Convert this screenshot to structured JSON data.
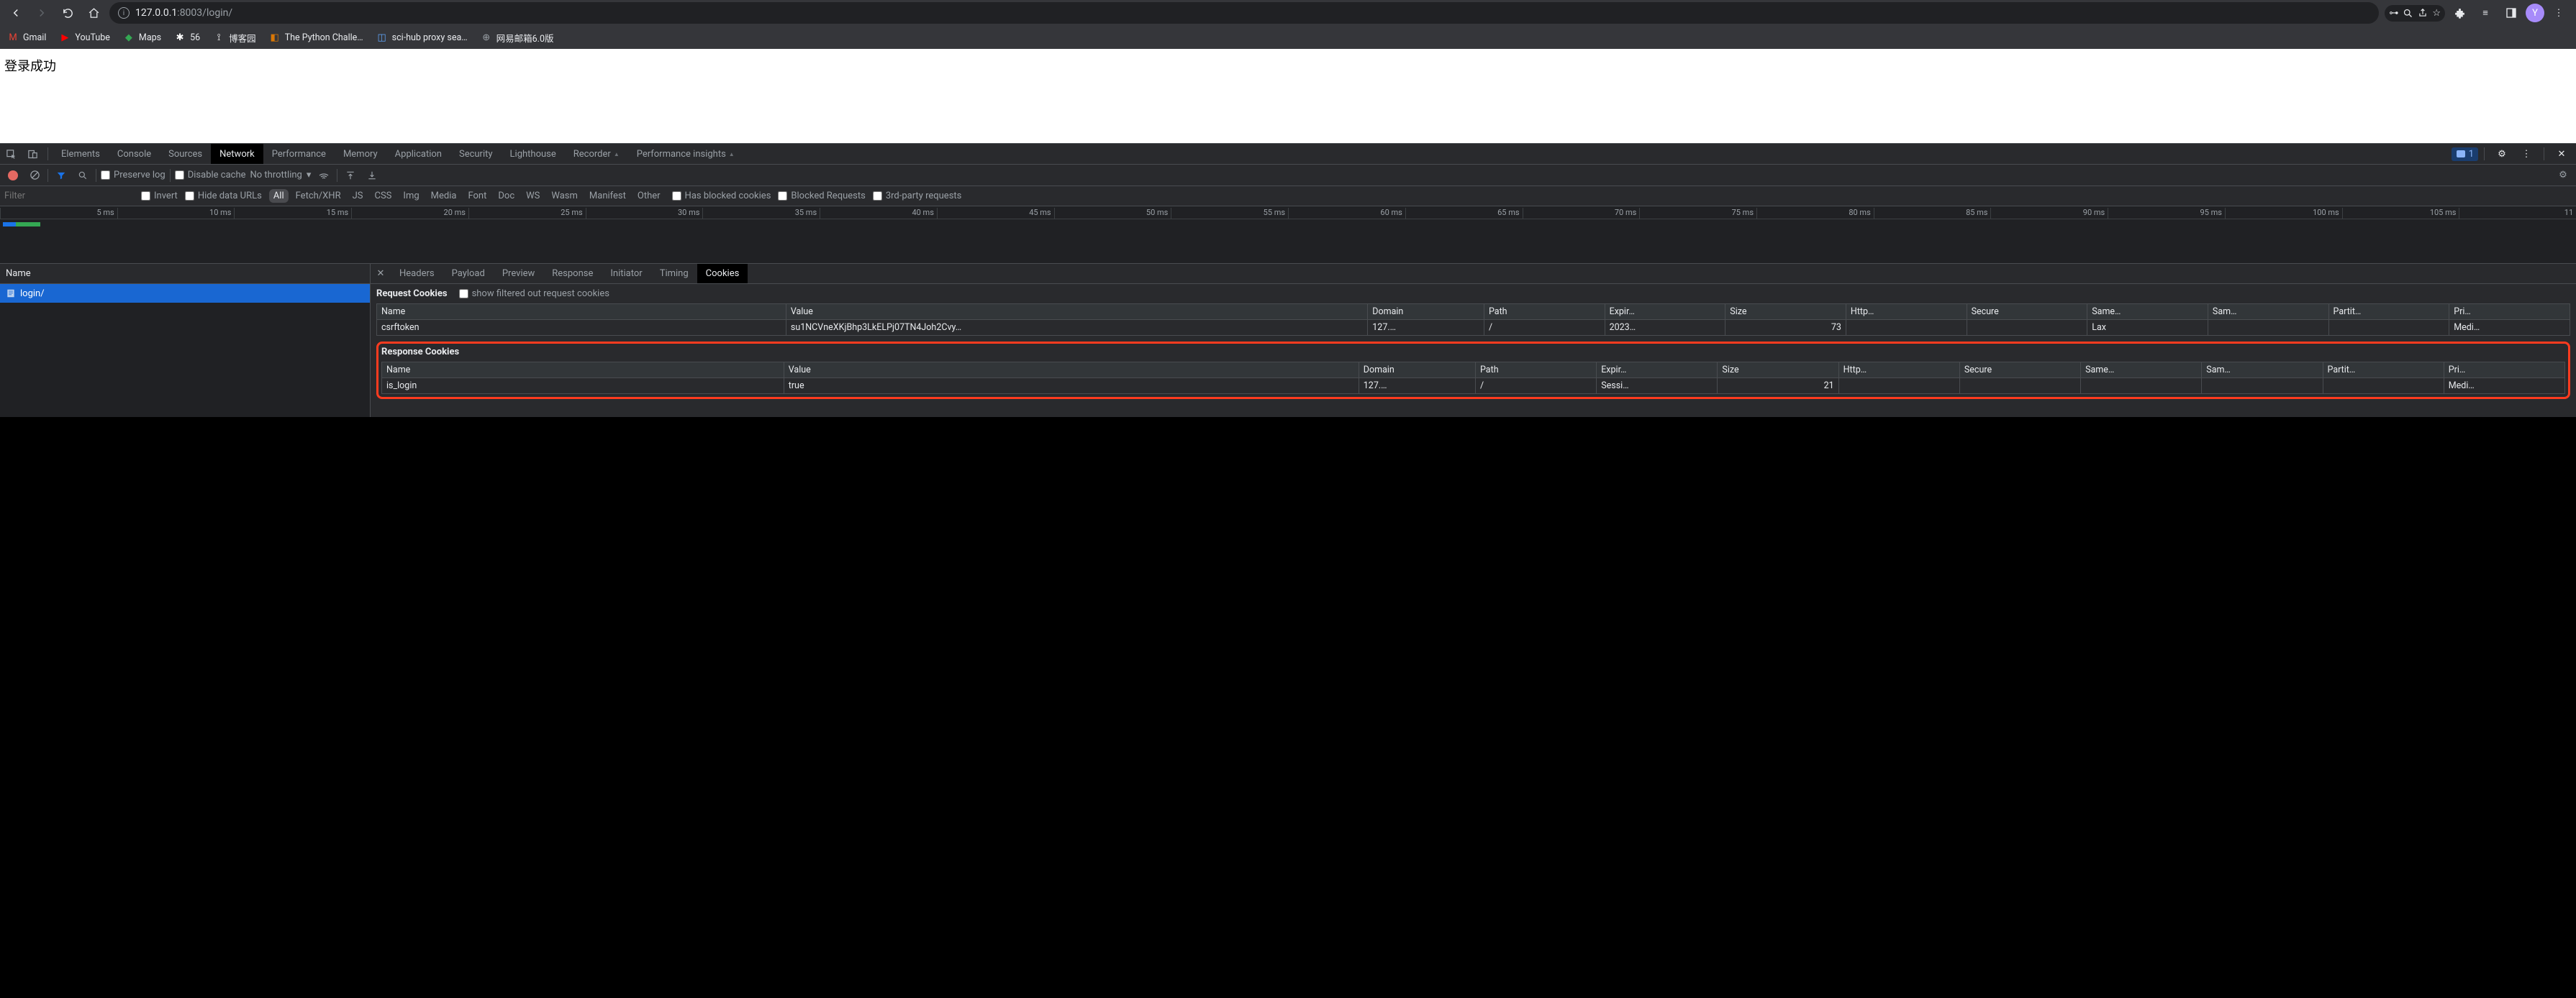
{
  "browser": {
    "url_host": "127.0.0.1",
    "url_port": ":8003",
    "url_path": "/login/",
    "profile_initial": "Y"
  },
  "bookmarks": [
    {
      "label": "Gmail",
      "icon": "M",
      "color": "#ea4335"
    },
    {
      "label": "YouTube",
      "icon": "▶",
      "color": "#ff0000"
    },
    {
      "label": "Maps",
      "icon": "◆",
      "color": "#34a853"
    },
    {
      "label": "56",
      "icon": "✱",
      "color": "#fff"
    },
    {
      "label": "博客园",
      "icon": "⟟",
      "color": "#fff"
    },
    {
      "label": "The Python Challe…",
      "icon": "◧",
      "color": "#d97706"
    },
    {
      "label": "sci-hub proxy sea…",
      "icon": "◫",
      "color": "#60a5fa"
    },
    {
      "label": "网易邮箱6.0版",
      "icon": "⊕",
      "color": "#9aa0a6"
    }
  ],
  "page": {
    "body_text": "登录成功"
  },
  "devtools": {
    "tabs": [
      "Elements",
      "Console",
      "Sources",
      "Network",
      "Performance",
      "Memory",
      "Application",
      "Security",
      "Lighthouse",
      "Recorder",
      "Performance insights"
    ],
    "active_tab": "Network",
    "issues_count": "1"
  },
  "net_toolbar": {
    "preserve_log": "Preserve log",
    "disable_cache": "Disable cache",
    "throttle": "No throttling"
  },
  "filter": {
    "placeholder": "Filter",
    "invert": "Invert",
    "hide_data": "Hide data URLs",
    "types": [
      "All",
      "Fetch/XHR",
      "JS",
      "CSS",
      "Img",
      "Media",
      "Font",
      "Doc",
      "WS",
      "Wasm",
      "Manifest",
      "Other"
    ],
    "active_type": "All",
    "has_blocked": "Has blocked cookies",
    "blocked_req": "Blocked Requests",
    "third_party": "3rd-party requests"
  },
  "timeline": {
    "ticks": [
      "5 ms",
      "10 ms",
      "15 ms",
      "20 ms",
      "25 ms",
      "30 ms",
      "35 ms",
      "40 ms",
      "45 ms",
      "50 ms",
      "55 ms",
      "60 ms",
      "65 ms",
      "70 ms",
      "75 ms",
      "80 ms",
      "85 ms",
      "90 ms",
      "95 ms",
      "100 ms",
      "105 ms",
      "11"
    ]
  },
  "net_list": {
    "header": "Name",
    "rows": [
      "login/"
    ]
  },
  "net_detail": {
    "tabs": [
      "Headers",
      "Payload",
      "Preview",
      "Response",
      "Initiator",
      "Timing",
      "Cookies"
    ],
    "active_tab": "Cookies",
    "request_title": "Request Cookies",
    "show_filtered": "show filtered out request cookies",
    "response_title": "Response Cookies",
    "columns": [
      "Name",
      "Value",
      "Domain",
      "Path",
      "Expir…",
      "Size",
      "Http…",
      "Secure",
      "Same…",
      "Sam…",
      "Partit…",
      "Pri…"
    ],
    "request_rows": [
      {
        "name": "csrftoken",
        "value": "su1NCVneXKjBhp3LkELPj07TN4Joh2Cvy…",
        "domain": "127.…",
        "path": "/",
        "expires": "2023…",
        "size": "73",
        "http": "",
        "secure": "",
        "same": "Lax",
        "sam": "",
        "partit": "",
        "pri": "Medi…"
      }
    ],
    "response_rows": [
      {
        "name": "is_login",
        "value": "true",
        "domain": "127.…",
        "path": "/",
        "expires": "Sessi…",
        "size": "21",
        "http": "",
        "secure": "",
        "same": "",
        "sam": "",
        "partit": "",
        "pri": "Medi…"
      }
    ]
  }
}
